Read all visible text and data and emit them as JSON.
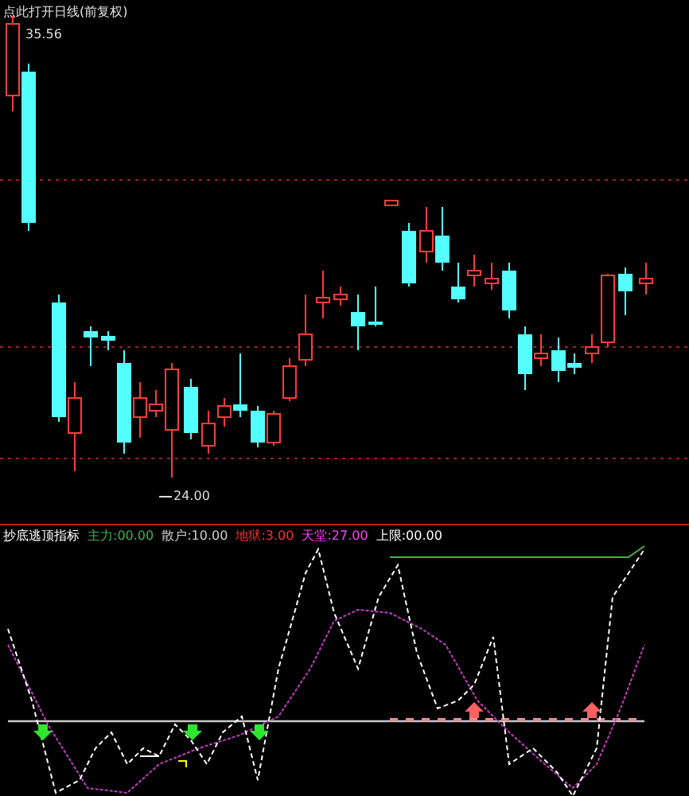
{
  "main_panel": {
    "title": "点此打开日线(前复权)",
    "price_high": "35.56",
    "price_low": "24.00"
  },
  "indicator_panel": {
    "name": "抄底逃顶指标",
    "legend": [
      {
        "label": "主力:00.00",
        "color": "#3cb44b"
      },
      {
        "label": "散户:10.00",
        "color": "#d0d0d0"
      },
      {
        "label": "地狱:3.00",
        "color": "#ff3030"
      },
      {
        "label": "天堂:27.00",
        "color": "#ff40ff"
      },
      {
        "label": "上限:00.00",
        "color": "#ffffff"
      }
    ]
  }
}
